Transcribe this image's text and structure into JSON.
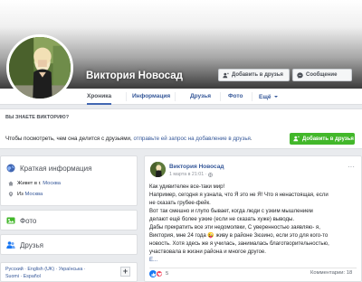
{
  "profile": {
    "name": "Виктория Новосад",
    "add_friend_label": "Добавить в друзья",
    "message_label": "Сообщение"
  },
  "nav": {
    "tabs": [
      {
        "label": "Хроника"
      },
      {
        "label": "Информация"
      },
      {
        "label": "Друзья"
      },
      {
        "label": "Фото"
      },
      {
        "label": "Ещё"
      }
    ]
  },
  "know_box": {
    "title": "ВЫ ЗНАЕТЕ ВИКТОРИЮ?",
    "text": "Чтобы посмотреть, чем она делится с друзьями, ",
    "link": "отправьте ей запрос на добавление в друзья",
    "text_end": ".",
    "button_label": "Добавить в друзья"
  },
  "intro": {
    "title": "Краткая информация",
    "lives_prefix": "Живет в г. ",
    "lives_city": "Москва",
    "from_prefix": "Из ",
    "from_city": "Москва"
  },
  "photos": {
    "title": "Фото"
  },
  "friends": {
    "title": "Друзья"
  },
  "languages": {
    "line1": "Русский · English (UK) · Українська ·",
    "line2": "Suomi · Español",
    "add_label": "+"
  },
  "post": {
    "author": "Виктория Новосад",
    "date": "1 марта в 21:01 ·",
    "more": "···",
    "lines": [
      "Как удивителен все-таки мир!",
      "Например, сегодня я узнала, что Я это не Я! Что я ненастоящая, если",
      "не сказать грубее-фейк.",
      "Вот так смешно и глупо бывает, когда люди с узким мышлением",
      "делают ещё более узкие (если не сказать хуже) выводы.",
      "Дабы прекратить все эти недомолвки, С уверенностью заявляю- я,",
      "Виктория, мне 24 года 😜 живу в районе Зюзино, если это для кого-то",
      "новость. Хотя здесь же я училась, занималась благотворительностью,",
      "участвовала в жизни района и многое другое."
    ],
    "see_more": "Е...",
    "see_more_link": "Ещё",
    "reactions_count": "5",
    "comments": "Комментарии: 18"
  }
}
